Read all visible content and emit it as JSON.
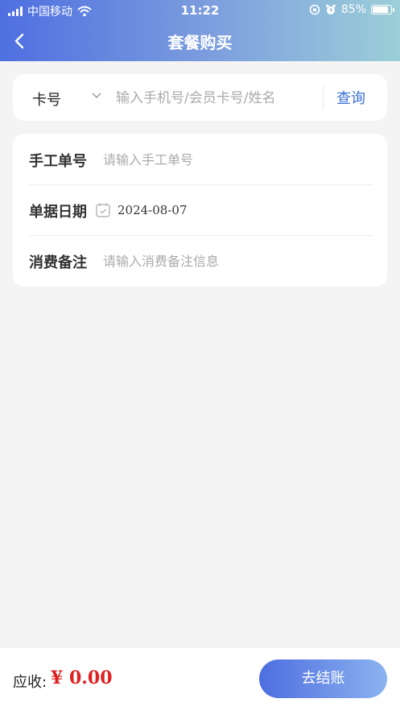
{
  "status_bar": {
    "carrier": "中国移动",
    "time": "11:22",
    "battery": "85%",
    "battery_level": 0.85
  },
  "nav": {
    "title": "套餐购买",
    "back_icon": "chevron-left-icon"
  },
  "search": {
    "type_label": "卡号",
    "placeholder": "输入手机号/会员卡号/姓名",
    "query_label": "查询"
  },
  "form": {
    "manual_no": {
      "label": "手工单号",
      "placeholder": "请输入手工单号"
    },
    "bill_date": {
      "label": "单据日期",
      "value": "2024-08-07"
    },
    "remark": {
      "label": "消费备注",
      "placeholder": "请输入消费备注信息"
    }
  },
  "footer": {
    "due_label": "应收:",
    "due_amount": "¥ 0.00",
    "checkout_label": "去结账"
  },
  "colors": {
    "accent": "#3a6fd6",
    "amount": "#e02020",
    "header_start": "#4e6fe0",
    "header_end": "#9ccfd8"
  }
}
